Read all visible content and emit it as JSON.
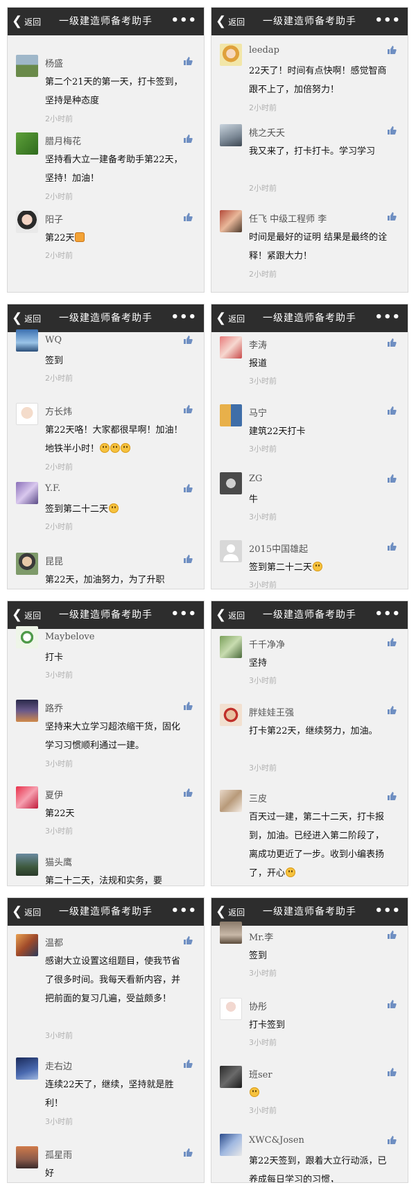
{
  "nav": {
    "back_label": "返回",
    "title": "一级建造师备考助手",
    "more_label": "•••"
  },
  "colors": {
    "nav_bg": "#2d2d2d",
    "bg": "#f1f1f1",
    "time": "#b0b0b0"
  },
  "panels": [
    {
      "comments": [
        {
          "name": "杨盛",
          "text": "第二个21天的第一天，打卡签到，坚持是种态度",
          "time": "2小时前"
        },
        {
          "name": "腊月梅花",
          "text": "坚持看大立一建备考助手第22天，坚持！加油！",
          "time": "2小时前"
        },
        {
          "name": "阳子",
          "text": "第22天",
          "time": "2小时前",
          "emoji": "fist"
        }
      ]
    },
    {
      "comments": [
        {
          "name": "leedap",
          "text": "22天了！时间有点快啊！感觉智商跟不上了，加倍努力！",
          "time": "2小时前"
        },
        {
          "name": "桃之夭夭",
          "text": "我又来了，打卡打卡。学习学习",
          "time": "2小时前"
        },
        {
          "name": "任飞 中级工程师 李",
          "text": "时间是最好的证明 结果是最终的诠释！紧跟大力！",
          "time": "2小时前"
        }
      ]
    },
    {
      "comments": [
        {
          "name": "WQ",
          "text": "签到",
          "time": "2小时前"
        },
        {
          "name": "方长炜",
          "text": "第22天咯！大家都很早啊！加油！地铁半小时！",
          "time": "2小时前",
          "emoji": "smile3"
        },
        {
          "name": "Y.F.",
          "text": "签到第二十二天",
          "time": "2小时前",
          "emoji": "smile"
        },
        {
          "name": "昆昆",
          "text": "第22天，加油努力，为了升职",
          "time": ""
        }
      ]
    },
    {
      "comments": [
        {
          "name": "李涛",
          "text": "报道",
          "time": "3小时前"
        },
        {
          "name": "马宁",
          "text": "建筑22天打卡",
          "time": "3小时前"
        },
        {
          "name": "ZG",
          "text": "牛",
          "time": "3小时前"
        },
        {
          "name": "2015中国雄起",
          "text": "签到第二十二天",
          "time": "3小时前",
          "emoji": "smile"
        }
      ]
    },
    {
      "comments": [
        {
          "name": "Maybelove",
          "text": "打卡",
          "time": "3小时前"
        },
        {
          "name": "路乔",
          "text": "坚持来大立学习超浓缩干货，固化学习习惯顺利通过一建。",
          "time": "3小时前"
        },
        {
          "name": "夏伊",
          "text": "第22天",
          "time": "3小时前"
        },
        {
          "name": "猫头鹰",
          "text": "第二十二天，法规和实务，要",
          "time": ""
        }
      ]
    },
    {
      "comments": [
        {
          "name": "千千净净",
          "text": "坚持",
          "time": "3小时前"
        },
        {
          "name": "胖娃娃王强",
          "text": "打卡第22天，继续努力，加油。",
          "time": "3小时前"
        },
        {
          "name": "三皮",
          "text": "百天过一建，第二十二天，打卡报到，加油。已经进入第二阶段了，离成功更近了一步。收到小编表扬了，开心",
          "time": "",
          "emoji": "smile"
        }
      ]
    },
    {
      "comments": [
        {
          "name": "温都",
          "text": "感谢大立设置这组题目，使我节省了很多时间。我每天看新内容，并把前面的复习几遍，受益颇多！",
          "time": "3小时前"
        },
        {
          "name": "走右边",
          "text": "连续22天了，继续，坚持就是胜利！",
          "time": "3小时前"
        },
        {
          "name": "孤星雨",
          "text": "好",
          "time": ""
        }
      ]
    },
    {
      "comments": [
        {
          "name": "Mr.李",
          "text": "签到",
          "time": "3小时前"
        },
        {
          "name": "协彤",
          "text": "打卡签到",
          "time": "3小时前"
        },
        {
          "name": "班ser",
          "text": "",
          "time": "3小时前",
          "emoji": "smile"
        },
        {
          "name": "XWC&Josen",
          "text": "第22天签到，跟着大立行动派，已养成每日学习的习惯，",
          "time": ""
        }
      ]
    }
  ]
}
